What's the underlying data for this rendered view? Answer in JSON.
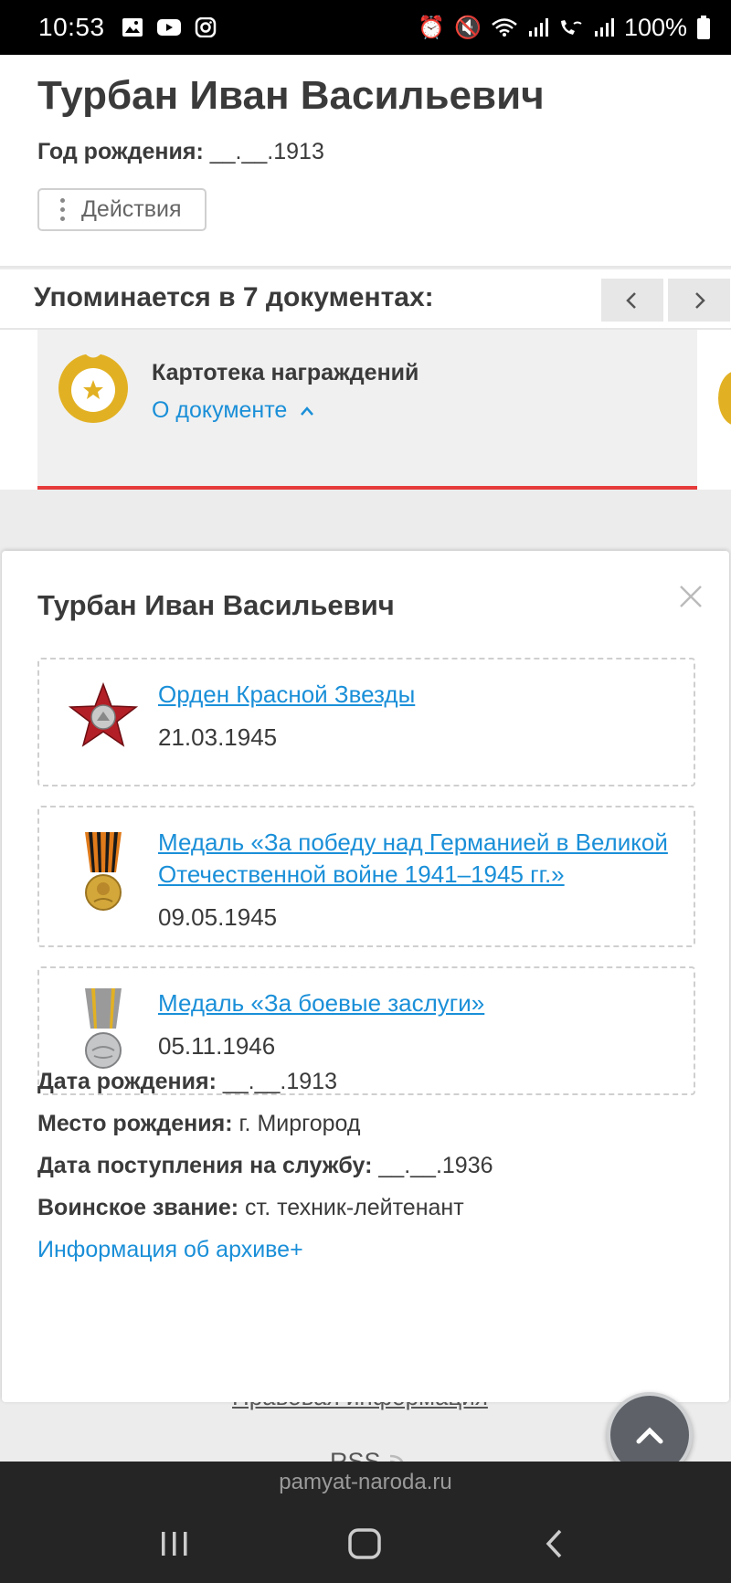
{
  "status_bar": {
    "time": "10:53",
    "battery": "100%",
    "left_icons": [
      "gallery-icon",
      "youtube-icon",
      "instagram-icon"
    ],
    "right_icons": [
      "alarm-icon",
      "mute-icon",
      "wifi-icon",
      "signal-icon",
      "wifi-call-icon",
      "signal-icon-2",
      "battery-icon"
    ]
  },
  "person": {
    "name": "Турбан Иван Васильевич",
    "birth_label": "Год рождения:",
    "birth_value": "__.__.1913",
    "actions_label": "Действия"
  },
  "mentions": {
    "title": "Упоминается в 7 документах:",
    "document": {
      "title": "Картотека награждений",
      "link": "О документе"
    }
  },
  "popup": {
    "title": "Турбан Иван Васильевич",
    "awards": [
      {
        "name": "Орден Красной Звезды",
        "date": "21.03.1945",
        "icon": "red-star-order-icon"
      },
      {
        "name": "Медаль «За победу над Германией в Великой Отечественной войне 1941–1945 гг.»",
        "date": "09.05.1945",
        "icon": "victory-medal-icon"
      },
      {
        "name": "Медаль «За боевые заслуги»",
        "date": "05.11.1946",
        "icon": "combat-merit-medal-icon"
      }
    ],
    "info": [
      {
        "label": "Дата рождения:",
        "value": "__.__.1913"
      },
      {
        "label": "Место рождения:",
        "value": "г. Миргород"
      },
      {
        "label": "Дата поступления на службу:",
        "value": "__.__.1936"
      },
      {
        "label": "Воинское звание:",
        "value": "ст. техник-лейтенант"
      }
    ],
    "archive_link": "Информация об архиве+"
  },
  "footer": {
    "legal": "Правовая информация",
    "rss": "RSS"
  },
  "browser": {
    "url": "pamyat-naroda.ru"
  },
  "colors": {
    "accent_link": "#1a8fd8",
    "red_line": "#e63a3a",
    "gold": "#e2b123"
  }
}
